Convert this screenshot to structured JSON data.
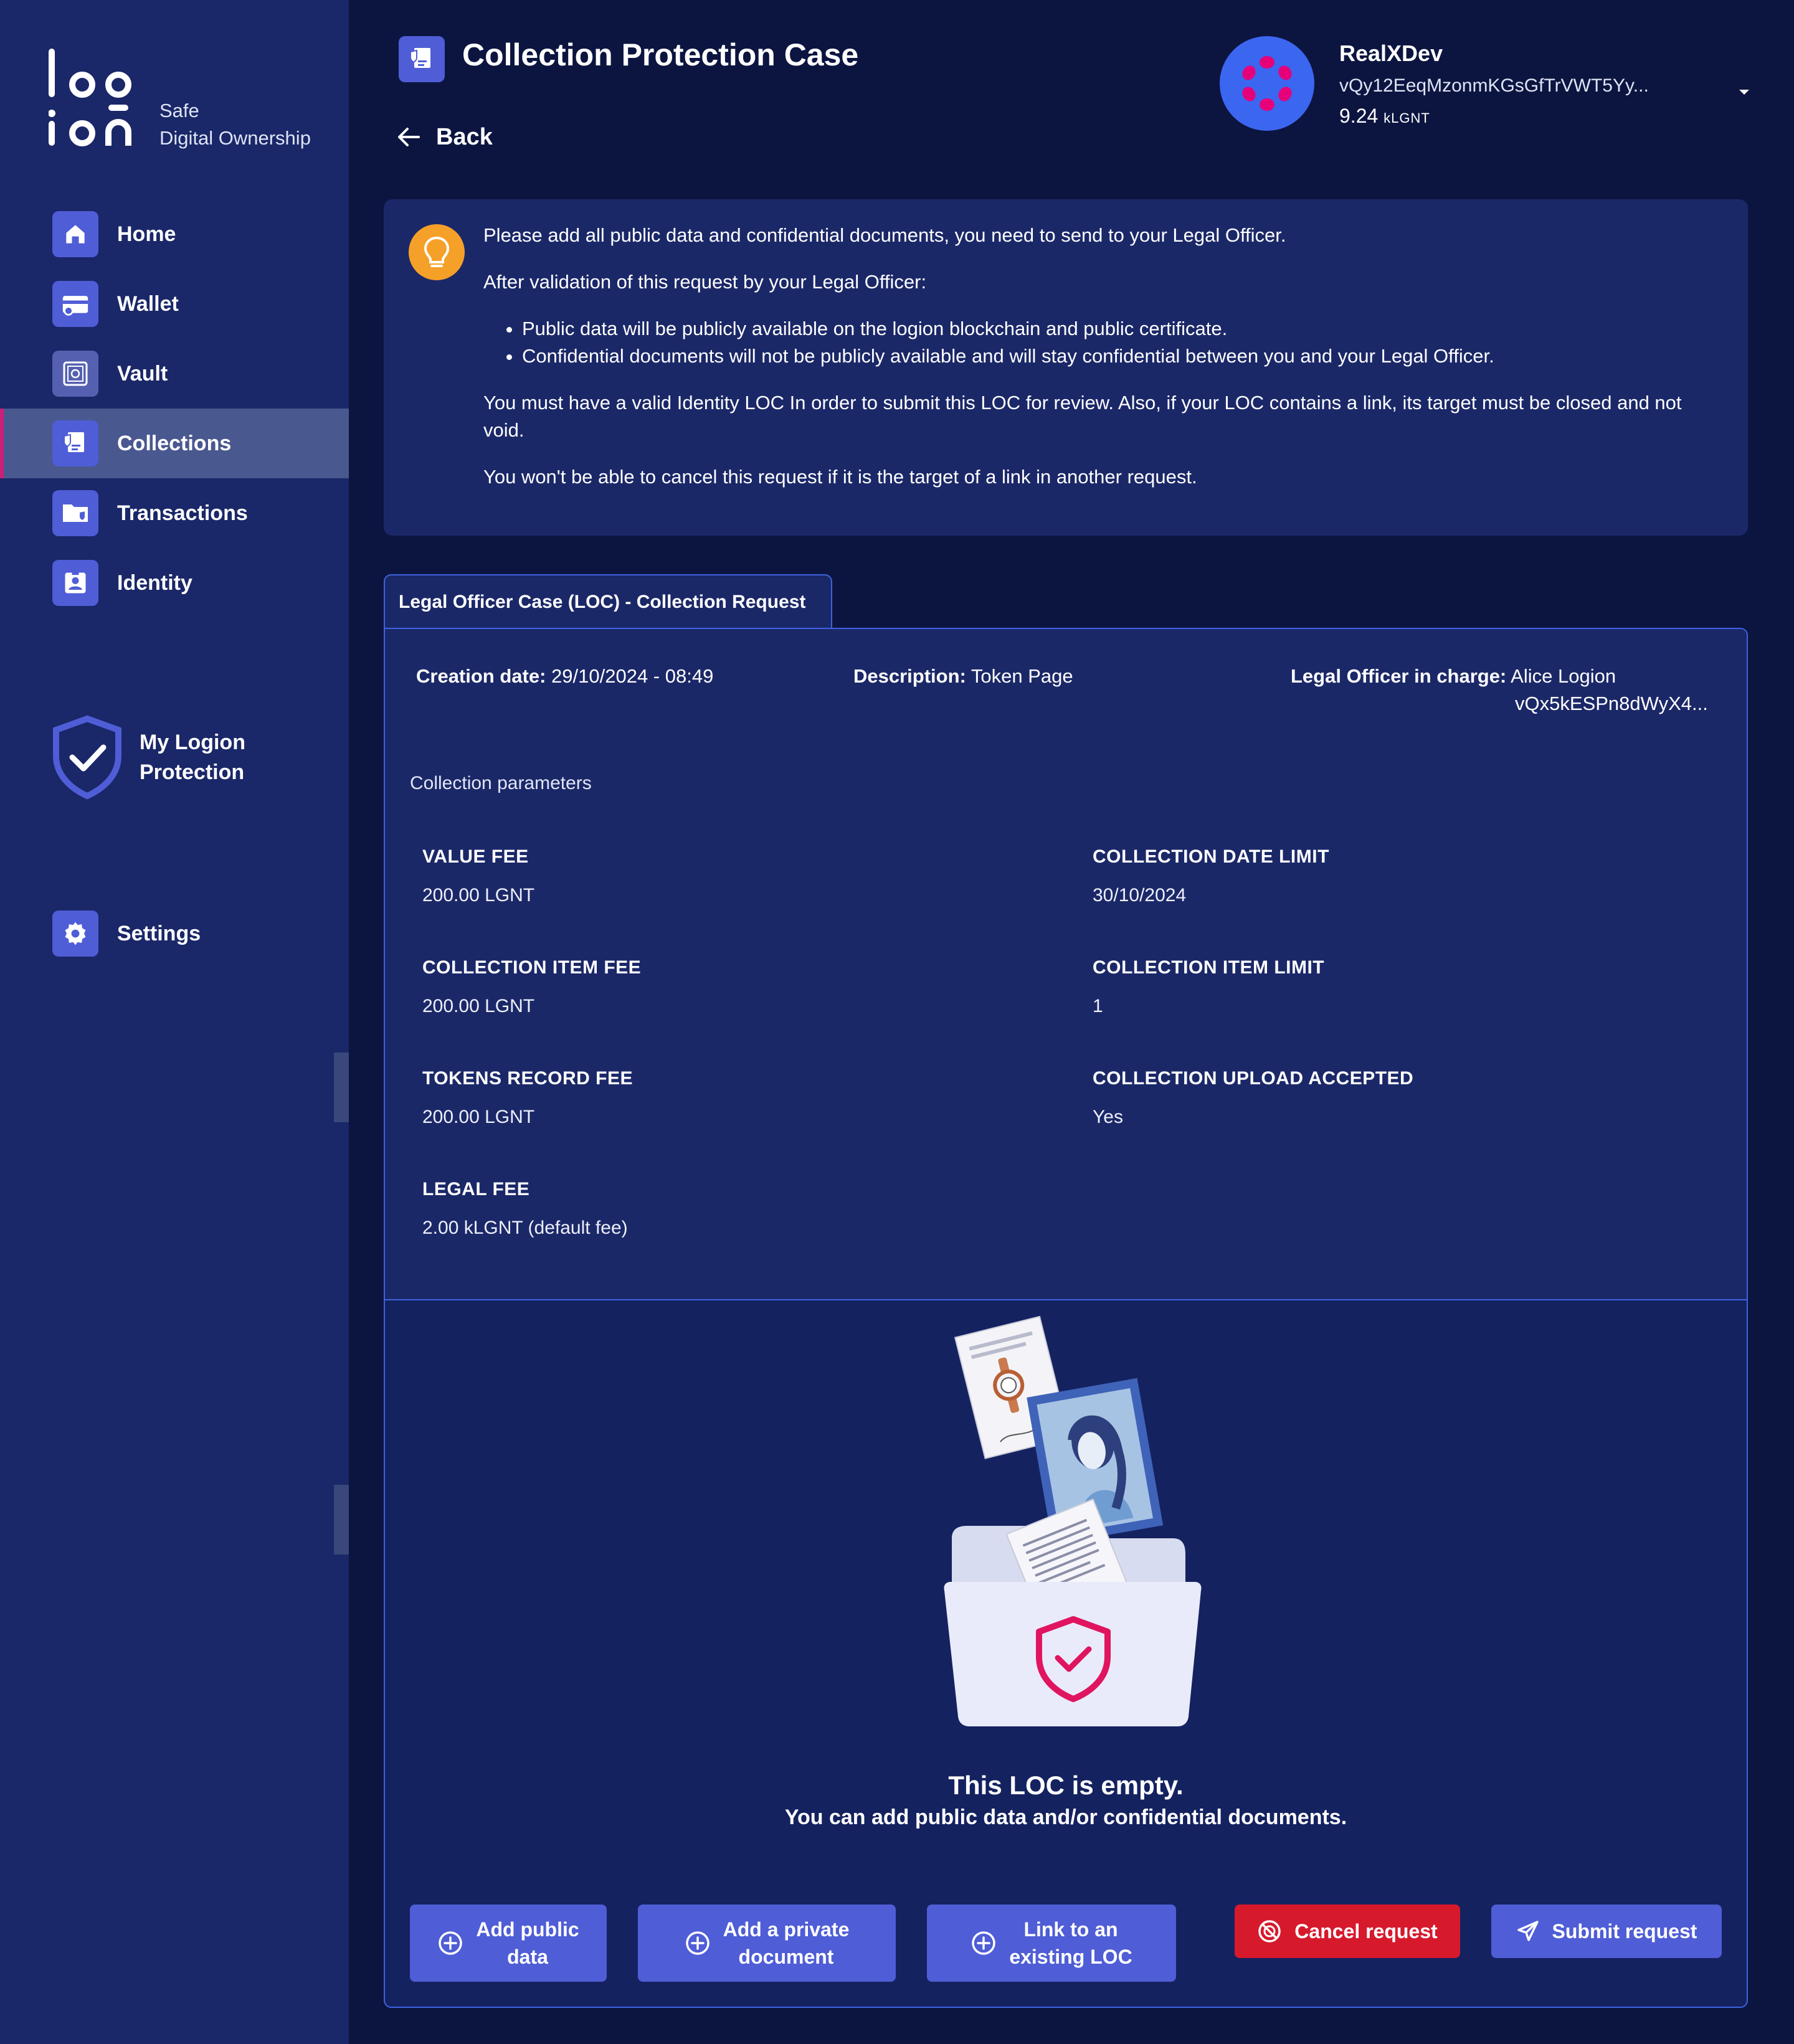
{
  "brand": {
    "logo_text": "logion",
    "tagline_line1": "Safe",
    "tagline_line2": "Digital Ownership"
  },
  "sidebar": {
    "items": [
      {
        "label": "Home",
        "icon": "home-icon"
      },
      {
        "label": "Wallet",
        "icon": "wallet-icon"
      },
      {
        "label": "Vault",
        "icon": "vault-icon"
      },
      {
        "label": "Collections",
        "icon": "collections-icon",
        "active": true
      },
      {
        "label": "Transactions",
        "icon": "transactions-icon"
      },
      {
        "label": "Identity",
        "icon": "identity-icon"
      }
    ],
    "protection_line1": "My Logion",
    "protection_line2": "Protection",
    "settings_label": "Settings"
  },
  "header": {
    "title": "Collection Protection Case",
    "back_label": "Back"
  },
  "account": {
    "name": "RealXDev",
    "address": "vQy12EeqMzonmKGsGfTrVWT5Yy...",
    "balance": "9.24",
    "balance_unit": "kLGNT"
  },
  "info": {
    "p1": "Please add all public data and confidential documents, you need to send to your Legal Officer.",
    "p2": "After validation of this request by your Legal Officer:",
    "bullet1": "Public data will be publicly available on the logion blockchain and public certificate.",
    "bullet2": "Confidential documents will not be publicly available and will stay confidential between you and your Legal Officer.",
    "p3": "You must have a valid Identity LOC In order to submit this LOC for review. Also, if your LOC contains a link, its target must be closed and not void.",
    "p4": "You won't be able to cancel this request if it is the target of a link in another request."
  },
  "loc": {
    "tab_label": "Legal Officer Case (LOC) - Collection Request",
    "creation_label": "Creation date:",
    "creation_value": "29/10/2024 - 08:49",
    "description_label": "Description:",
    "description_value": "Token Page",
    "officer_label": "Legal Officer in charge:",
    "officer_name": "Alice Logion",
    "officer_address": "vQx5kESPn8dWyX4...",
    "params_title": "Collection parameters",
    "params": {
      "value_fee": {
        "label": "VALUE FEE",
        "value": "200.00 LGNT"
      },
      "collection_date_limit": {
        "label": "COLLECTION DATE LIMIT",
        "value": "30/10/2024"
      },
      "collection_item_fee": {
        "label": "COLLECTION ITEM FEE",
        "value": "200.00 LGNT"
      },
      "collection_item_limit": {
        "label": "COLLECTION ITEM LIMIT",
        "value": "1"
      },
      "tokens_record_fee": {
        "label": "TOKENS RECORD FEE",
        "value": "200.00 LGNT"
      },
      "collection_upload_accepted": {
        "label": "COLLECTION UPLOAD ACCEPTED",
        "value": "Yes"
      },
      "legal_fee": {
        "label": "LEGAL FEE",
        "value": "2.00 kLGNT (default fee)"
      }
    },
    "empty_title": "This LOC is empty.",
    "empty_subtitle": "You can add public data and/or confidential documents."
  },
  "actions": {
    "add_public_line1": "Add public",
    "add_public_line2": "data",
    "add_private_line1": "Add a private",
    "add_private_line2": "document",
    "link_line1": "Link to an",
    "link_line2": "existing LOC",
    "cancel": "Cancel request",
    "submit": "Submit request"
  },
  "colors": {
    "background": "#0c1540",
    "sidebar": "#1a2768",
    "accent_blue": "#4f5dd6",
    "danger_red": "#d7192c",
    "active_marker": "#cc1f7b",
    "bulb_orange": "#f5a028",
    "avatar_blue": "#3b66f0"
  }
}
